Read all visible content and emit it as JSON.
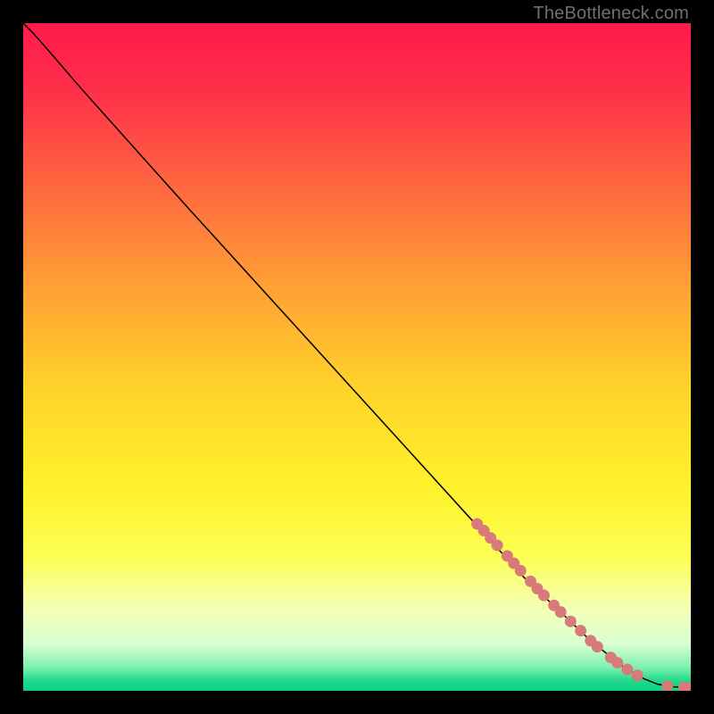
{
  "watermark": "TheBottleneck.com",
  "chart_data": {
    "type": "line",
    "title": "",
    "xlabel": "",
    "ylabel": "",
    "xlim": [
      0,
      100
    ],
    "ylim": [
      0,
      100
    ],
    "grid": false,
    "legend": false,
    "background_gradient": {
      "stops": [
        {
          "offset": 0.0,
          "color": "#ff1a4b"
        },
        {
          "offset": 0.1,
          "color": "#ff2f4a"
        },
        {
          "offset": 0.25,
          "color": "#ff6a3f"
        },
        {
          "offset": 0.4,
          "color": "#ffa233"
        },
        {
          "offset": 0.55,
          "color": "#ffd42a"
        },
        {
          "offset": 0.7,
          "color": "#fff22c"
        },
        {
          "offset": 0.8,
          "color": "#fdff55"
        },
        {
          "offset": 0.88,
          "color": "#f3ffb9"
        },
        {
          "offset": 0.93,
          "color": "#d8ffd0"
        },
        {
          "offset": 0.965,
          "color": "#7cf0b0"
        },
        {
          "offset": 0.985,
          "color": "#22d98c"
        },
        {
          "offset": 1.0,
          "color": "#0bd183"
        }
      ]
    },
    "series": [
      {
        "name": "curve",
        "type": "line",
        "color": "#000000",
        "width": 1.5,
        "points": [
          {
            "x": 0.0,
            "y": 100.0
          },
          {
            "x": 1.5,
            "y": 98.5
          },
          {
            "x": 3.0,
            "y": 96.8
          },
          {
            "x": 5.0,
            "y": 94.5
          },
          {
            "x": 8.0,
            "y": 91.0
          },
          {
            "x": 12.0,
            "y": 86.5
          },
          {
            "x": 18.0,
            "y": 79.8
          },
          {
            "x": 25.0,
            "y": 72.0
          },
          {
            "x": 35.0,
            "y": 61.0
          },
          {
            "x": 45.0,
            "y": 50.0
          },
          {
            "x": 55.0,
            "y": 39.0
          },
          {
            "x": 65.0,
            "y": 28.0
          },
          {
            "x": 75.0,
            "y": 17.0
          },
          {
            "x": 85.0,
            "y": 7.5
          },
          {
            "x": 90.0,
            "y": 3.5
          },
          {
            "x": 93.0,
            "y": 1.8
          },
          {
            "x": 95.0,
            "y": 1.0
          },
          {
            "x": 97.0,
            "y": 0.6
          },
          {
            "x": 100.0,
            "y": 0.5
          }
        ]
      },
      {
        "name": "markers",
        "type": "scatter",
        "color": "#d97a7a",
        "radius": 6.5,
        "points": [
          {
            "x": 68.0,
            "y": 25.0
          },
          {
            "x": 69.0,
            "y": 24.0
          },
          {
            "x": 70.0,
            "y": 22.9
          },
          {
            "x": 71.0,
            "y": 21.8
          },
          {
            "x": 72.5,
            "y": 20.2
          },
          {
            "x": 73.5,
            "y": 19.1
          },
          {
            "x": 74.5,
            "y": 18.0
          },
          {
            "x": 76.0,
            "y": 16.4
          },
          {
            "x": 77.0,
            "y": 15.3
          },
          {
            "x": 78.0,
            "y": 14.3
          },
          {
            "x": 79.5,
            "y": 12.8
          },
          {
            "x": 80.5,
            "y": 11.8
          },
          {
            "x": 82.0,
            "y": 10.4
          },
          {
            "x": 83.5,
            "y": 9.0
          },
          {
            "x": 85.0,
            "y": 7.5
          },
          {
            "x": 86.0,
            "y": 6.6
          },
          {
            "x": 88.0,
            "y": 5.0
          },
          {
            "x": 89.0,
            "y": 4.2
          },
          {
            "x": 90.5,
            "y": 3.2
          },
          {
            "x": 92.0,
            "y": 2.3
          },
          {
            "x": 96.5,
            "y": 0.7
          },
          {
            "x": 99.0,
            "y": 0.5
          },
          {
            "x": 100.0,
            "y": 0.5
          }
        ]
      }
    ]
  }
}
